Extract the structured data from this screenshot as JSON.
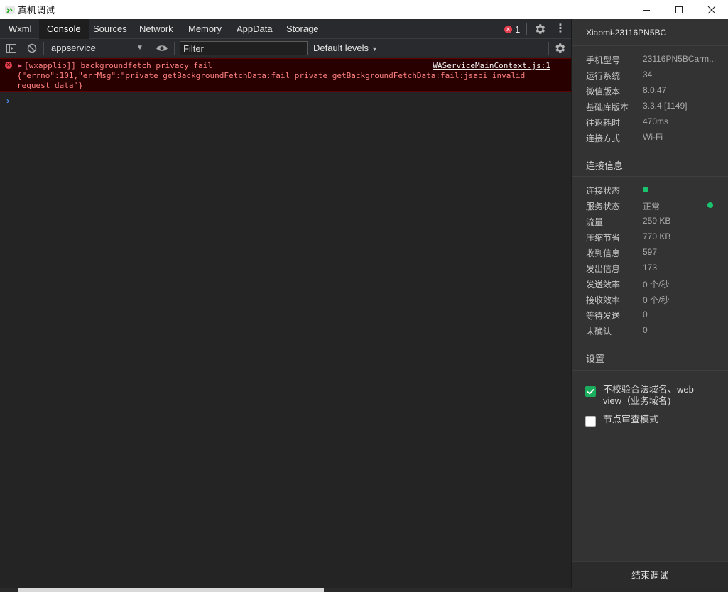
{
  "window": {
    "title": "真机调试",
    "app_icon": "wechat-devtools-icon"
  },
  "tabs": [
    "Wxml",
    "Console",
    "Sources",
    "Network",
    "Memory",
    "AppData",
    "Storage"
  ],
  "active_tab": "Console",
  "error_count": "1",
  "toolbar": {
    "context": "appservice",
    "filter_placeholder": "Filter",
    "levels": "Default levels"
  },
  "console": {
    "messages": [
      {
        "level": "error",
        "line1": "[wxapplib]] backgroundfetch privacy fail",
        "source": "WAServiceMainContext.js:1",
        "line2": "{\"errno\":101,\"errMsg\":\"private_getBackgroundFetchData:fail private_getBackgroundFetchData:fail:jsapi invalid request data\"}"
      }
    ],
    "prompt": "›"
  },
  "device": {
    "name": "Xiaomi-23116PN5BC",
    "info": [
      {
        "label": "手机型号",
        "value": "23116PN5BCarm..."
      },
      {
        "label": "运行系统",
        "value": "34"
      },
      {
        "label": "微信版本",
        "value": "8.0.47"
      },
      {
        "label": "基础库版本",
        "value": "3.3.4 [1149]"
      },
      {
        "label": "往返耗时",
        "value": "470ms"
      },
      {
        "label": "连接方式",
        "value": "Wi-Fi"
      }
    ]
  },
  "connection": {
    "title": "连接信息",
    "items": [
      {
        "label": "连接状态",
        "value": ""
      },
      {
        "label": "服务状态",
        "value": "正常"
      },
      {
        "label": "流量",
        "value": "259 KB"
      },
      {
        "label": "压缩节省",
        "value": "770 KB"
      },
      {
        "label": "收到信息",
        "value": "597"
      },
      {
        "label": "发出信息",
        "value": "173"
      },
      {
        "label": "发送效率",
        "value": "0 个/秒"
      },
      {
        "label": "接收效率",
        "value": "0 个/秒"
      },
      {
        "label": "等待发送",
        "value": "0"
      },
      {
        "label": "未确认",
        "value": "0"
      }
    ],
    "status_color": "#19c46e"
  },
  "settings": {
    "title": "设置",
    "options": [
      {
        "label": "不校验合法域名、web-view（业务域名)",
        "checked": true
      },
      {
        "label": "节点审查模式",
        "checked": false
      }
    ]
  },
  "end_button": "结束调试"
}
